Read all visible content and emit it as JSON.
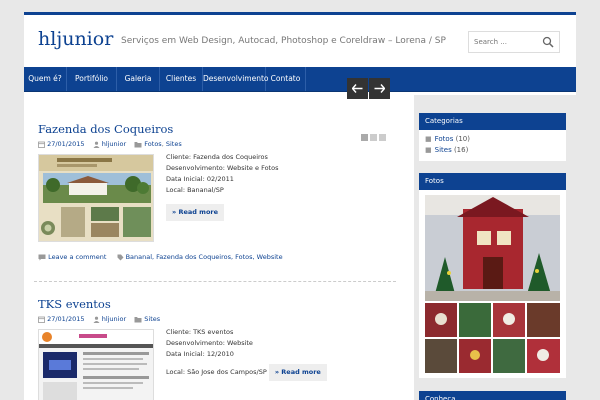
{
  "header": {
    "site_title": "hljunior",
    "tagline": "Serviços em Web Design, Autocad, Photoshop e Coreldraw – Lorena / SP",
    "search_placeholder": "Search ..."
  },
  "nav": {
    "items": [
      {
        "label": "Quem é?"
      },
      {
        "label": "Portifólio"
      },
      {
        "label": "Galeria"
      },
      {
        "label": "Clientes"
      },
      {
        "label": "Desenvolvimento"
      },
      {
        "label": "Contato"
      }
    ]
  },
  "slider": {
    "prev": "←",
    "next": "→"
  },
  "posts": [
    {
      "title": "Fazenda dos Coqueiros",
      "date": "27/01/2015",
      "author": "hljunior",
      "categories": [
        "Fotos",
        "Sites"
      ],
      "details": [
        "Cliente: Fazenda dos Coqueiros",
        "Desenvolvimento: Website e Fotos",
        "Data Inicial: 02/2011",
        "Local: Bananal/SP"
      ],
      "read_more": "» Read more",
      "comment_link": "Leave a comment",
      "tags": "Bananal, Fazenda dos Coqueiros, Fotos, Website"
    },
    {
      "title": "TKS eventos",
      "date": "27/01/2015",
      "author": "hljunior",
      "categories": [
        "Sites"
      ],
      "details": [
        "Cliente: TKS eventos",
        "Desenvolvimento: Website",
        "Data Inicial: 12/2010",
        "Local: São Jose dos Campos/SP"
      ],
      "read_more": "» Read more"
    }
  ],
  "sidebar": {
    "categorias": {
      "title": "Categorias",
      "items": [
        {
          "label": "Fotos",
          "count": "(10)"
        },
        {
          "label": "Sites",
          "count": "(16)"
        }
      ]
    },
    "fotos": {
      "title": "Fotos"
    },
    "conheca": {
      "title": "Conheça"
    }
  },
  "colors": {
    "brand": "#0d4291",
    "link": "#0d4291"
  },
  "icons": [
    "search-icon",
    "calendar-icon",
    "user-icon",
    "folder-icon",
    "comment-icon",
    "tag-icon",
    "arrow-left-icon",
    "arrow-right-icon"
  ]
}
